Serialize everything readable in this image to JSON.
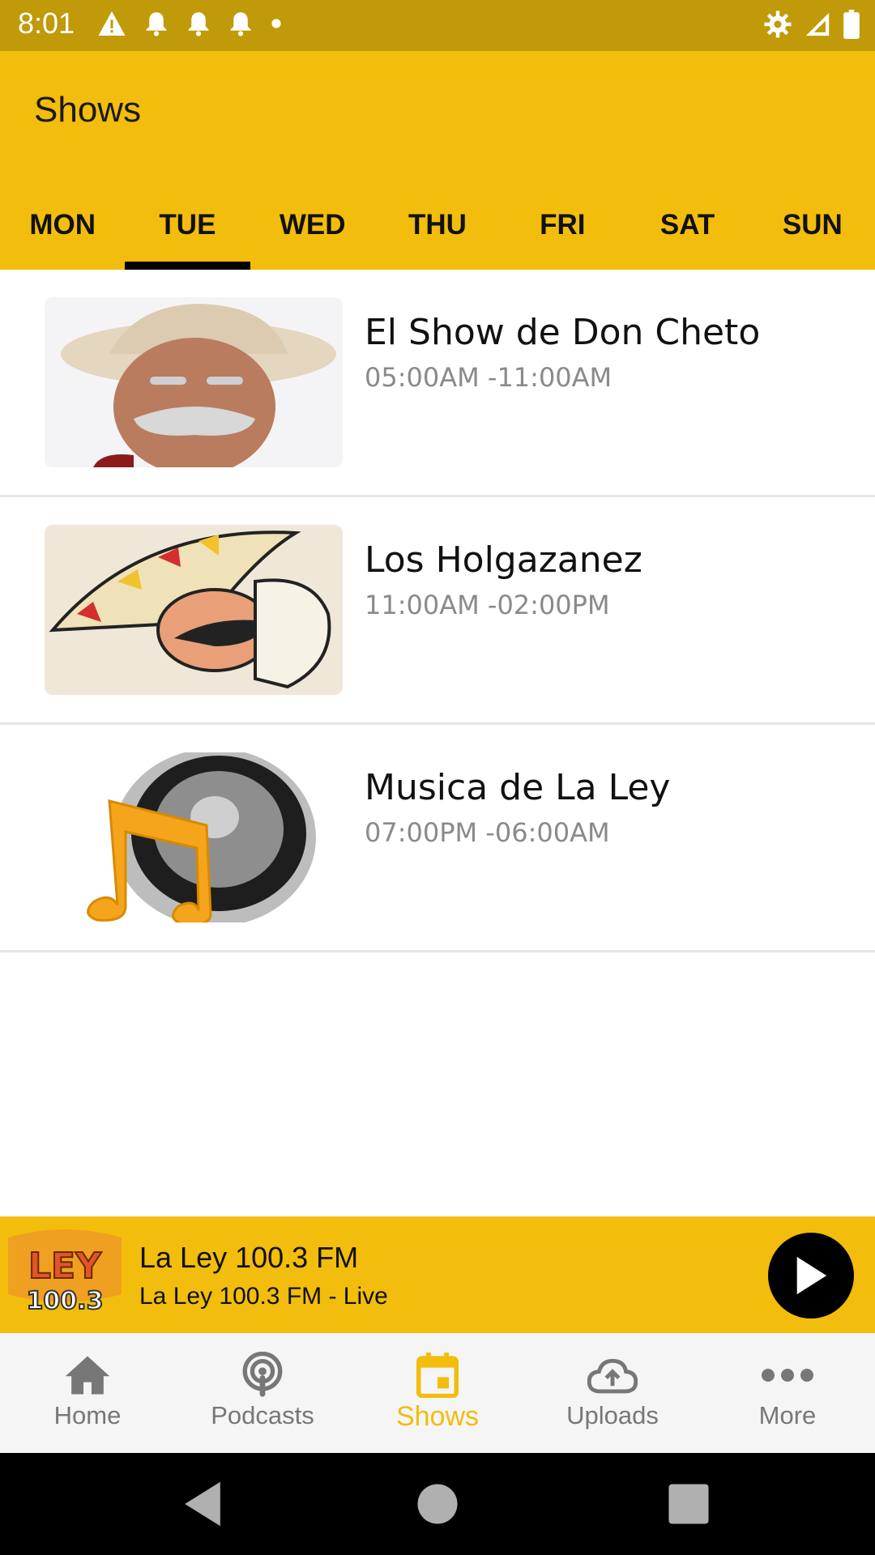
{
  "status_bar": {
    "time": "8:01"
  },
  "app_bar": {
    "title": "Shows"
  },
  "tabs": [
    {
      "label": "MON",
      "active": false
    },
    {
      "label": "TUE",
      "active": true
    },
    {
      "label": "WED",
      "active": false
    },
    {
      "label": "THU",
      "active": false
    },
    {
      "label": "FRI",
      "active": false
    },
    {
      "label": "SAT",
      "active": false
    },
    {
      "label": "SUN",
      "active": false
    }
  ],
  "shows": [
    {
      "name": "El Show de Don Cheto",
      "time": "05:00AM -11:00AM",
      "image": "host-cowboy-hat-photo"
    },
    {
      "name": "Los Holgazanez",
      "time": "11:00AM -02:00PM",
      "image": "sombrero-cartoon-character"
    },
    {
      "name": "Musica de La Ley",
      "time": "07:00PM -06:00AM",
      "image": "speaker-music-note"
    }
  ],
  "player": {
    "title": "La Ley 100.3 FM",
    "subtitle": "La Ley 100.3 FM - Live",
    "logo_text": "LA LEY 100.3"
  },
  "bottom_nav": [
    {
      "label": "Home",
      "icon": "home-icon",
      "active": false
    },
    {
      "label": "Podcasts",
      "icon": "podcast-icon",
      "active": false
    },
    {
      "label": "Shows",
      "icon": "calendar-icon",
      "active": true
    },
    {
      "label": "Uploads",
      "icon": "cloud-upload-icon",
      "active": false
    },
    {
      "label": "More",
      "icon": "more-dots-icon",
      "active": false
    }
  ],
  "colors": {
    "accent": "#f2bd0c",
    "status_bar": "#c09a08",
    "inactive_nav": "#777777"
  }
}
